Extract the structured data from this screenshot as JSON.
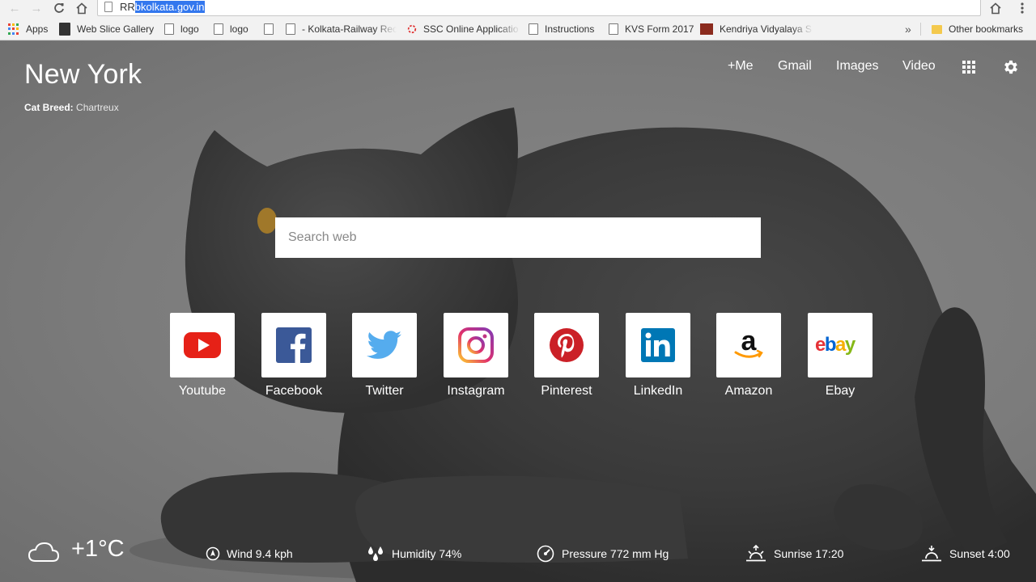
{
  "browser": {
    "url_prefix": "RR",
    "url_selected": "bkolkata.gov.in",
    "bookmarks": [
      {
        "label": "Apps"
      },
      {
        "label": "Web Slice Gallery"
      },
      {
        "label": "logo"
      },
      {
        "label": "logo"
      },
      {
        "label": "- Kolkata-Railway Rec"
      },
      {
        "label": "SSC Online Applicatio"
      },
      {
        "label": "Instructions"
      },
      {
        "label": "KVS Form 2017"
      },
      {
        "label": "Kendriya Vidyalaya S"
      }
    ],
    "overflow": "»",
    "other_bookmarks": "Other bookmarks"
  },
  "header": {
    "city": "New York",
    "breed_label": "Cat Breed:",
    "breed_value": "Chartreux",
    "links": [
      "+Me",
      "Gmail",
      "Images",
      "Video"
    ]
  },
  "search": {
    "placeholder": "Search web"
  },
  "tiles": [
    {
      "label": "Youtube",
      "icon": "youtube-icon"
    },
    {
      "label": "Facebook",
      "icon": "facebook-icon"
    },
    {
      "label": "Twitter",
      "icon": "twitter-icon"
    },
    {
      "label": "Instagram",
      "icon": "instagram-icon"
    },
    {
      "label": "Pinterest",
      "icon": "pinterest-icon"
    },
    {
      "label": "LinkedIn",
      "icon": "linkedin-icon"
    },
    {
      "label": "Amazon",
      "icon": "amazon-icon"
    },
    {
      "label": "Ebay",
      "icon": "ebay-icon"
    }
  ],
  "weather": {
    "temperature": "+1°C",
    "wind": "Wind 9.4 kph",
    "humidity": "Humidity 74%",
    "pressure": "Pressure 772 mm Hg",
    "sunrise": "Sunrise 17:20",
    "sunset": "Sunset 4:00"
  },
  "colors": {
    "youtube": "#e62117",
    "facebook": "#3b5998",
    "twitter": "#55acee",
    "pinterest": "#cb2027",
    "linkedin": "#0077b5",
    "selection": "#3377ee"
  }
}
